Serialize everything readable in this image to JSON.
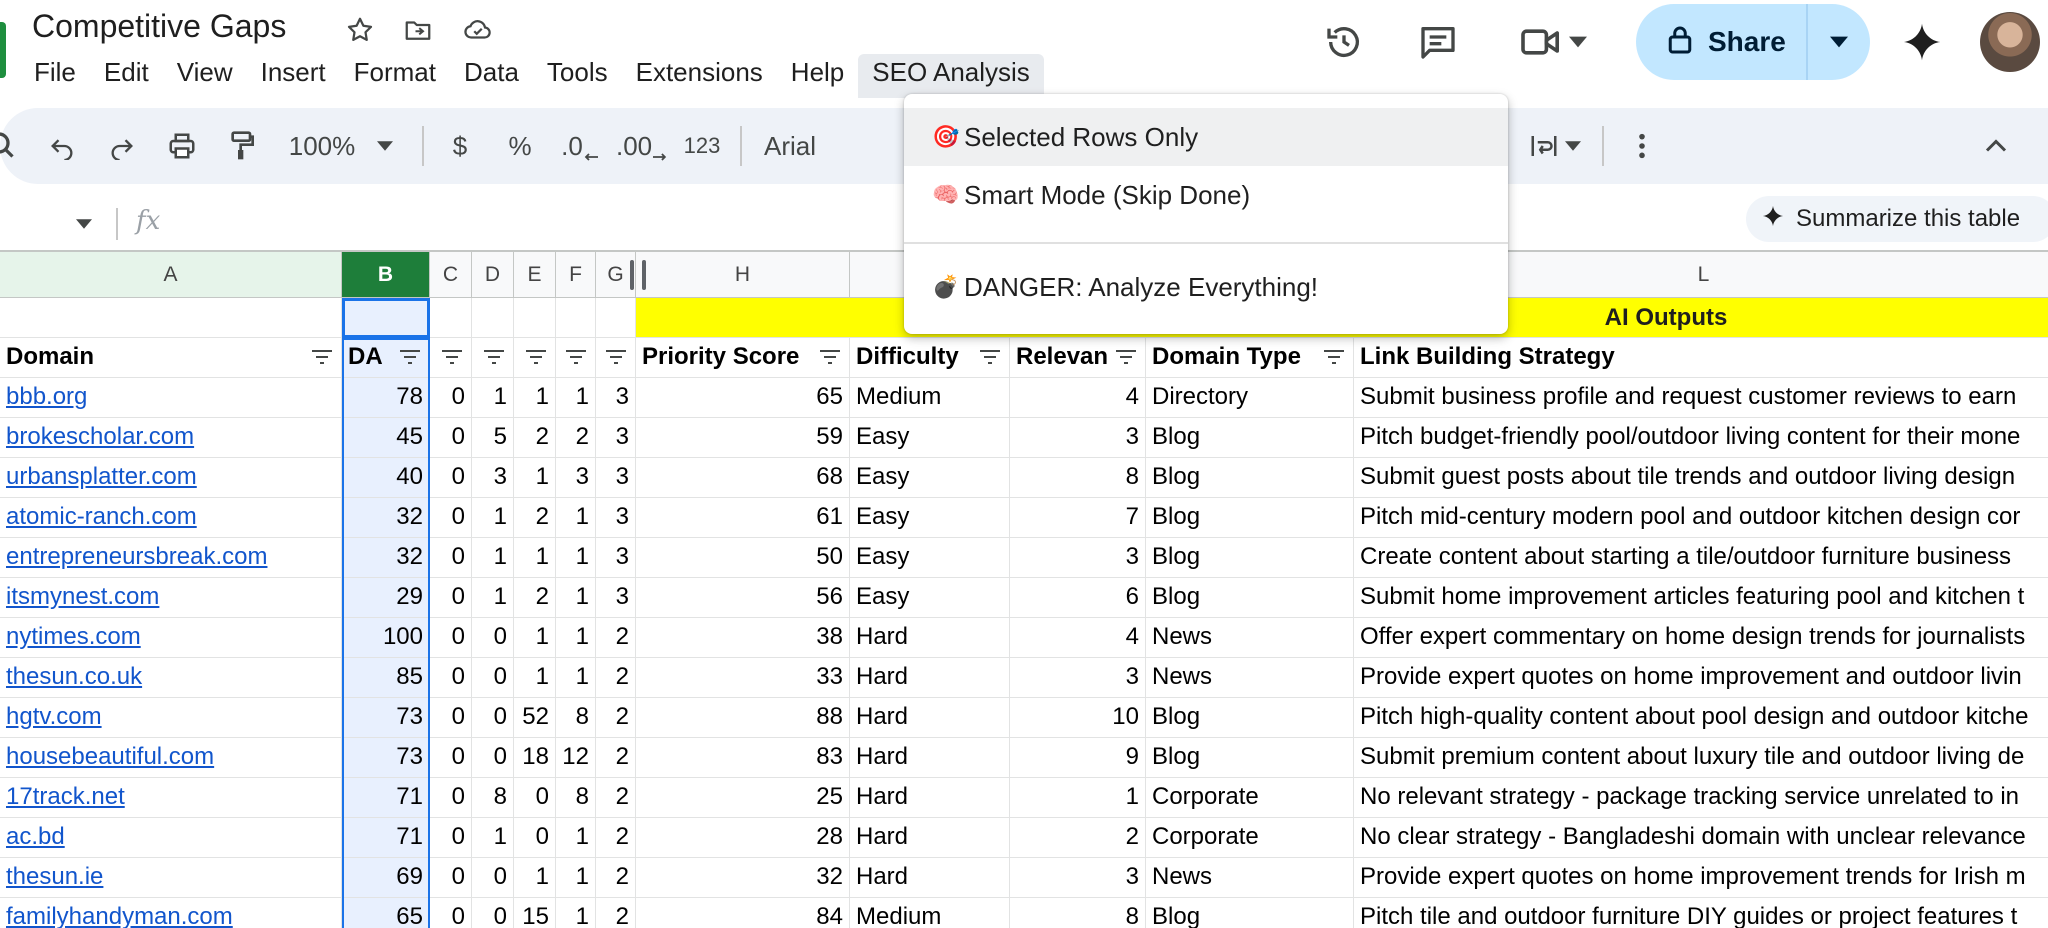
{
  "app": {
    "title": "Competitive Gaps"
  },
  "menu": [
    "File",
    "Edit",
    "View",
    "Insert",
    "Format",
    "Data",
    "Tools",
    "Extensions",
    "Help",
    "SEO Analysis"
  ],
  "share": {
    "label": "Share"
  },
  "toolbar": {
    "zoom": "100%",
    "currency": "$",
    "percent": "%",
    "dec_decrease": ".0",
    "dec_increase": ".00",
    "number_format": "123",
    "font": "Arial"
  },
  "formula_bar": {
    "fx": "fx",
    "summarize_label": "Summarize this table"
  },
  "dropdown": {
    "items": [
      {
        "emoji": "🎯",
        "label": "Selected Rows Only"
      },
      {
        "emoji": "🧠",
        "label": "Smart Mode (Skip Done)"
      },
      {
        "emoji": "💣",
        "label": "DANGER: Analyze Everything!"
      }
    ]
  },
  "grid": {
    "columns": [
      "A",
      "B",
      "C",
      "D",
      "E",
      "F",
      "G",
      "H",
      "L"
    ],
    "ai_outputs_label": "AI Outputs",
    "headers": [
      "Domain",
      "DA",
      "",
      "",
      "",
      "",
      "",
      "Priority Score",
      "Difficulty",
      "Relevan",
      "Domain Type",
      "Link Building Strategy"
    ],
    "rows": [
      [
        "bbb.org",
        "78",
        "0",
        "1",
        "1",
        "1",
        "3",
        "65",
        "Medium",
        "4",
        "Directory",
        "Submit business profile and request customer reviews to earn"
      ],
      [
        "brokescholar.com",
        "45",
        "0",
        "5",
        "2",
        "2",
        "3",
        "59",
        "Easy",
        "3",
        "Blog",
        "Pitch budget-friendly pool/outdoor living content for their mone"
      ],
      [
        "urbansplatter.com",
        "40",
        "0",
        "3",
        "1",
        "3",
        "3",
        "68",
        "Easy",
        "8",
        "Blog",
        "Submit guest posts about tile trends and outdoor living design"
      ],
      [
        "atomic-ranch.com",
        "32",
        "0",
        "1",
        "2",
        "1",
        "3",
        "61",
        "Easy",
        "7",
        "Blog",
        "Pitch mid-century modern pool and outdoor kitchen design cor"
      ],
      [
        "entrepreneursbreak.com",
        "32",
        "0",
        "1",
        "1",
        "1",
        "3",
        "50",
        "Easy",
        "3",
        "Blog",
        "Create content about starting a tile/outdoor furniture business"
      ],
      [
        "itsmynest.com",
        "29",
        "0",
        "1",
        "2",
        "1",
        "3",
        "56",
        "Easy",
        "6",
        "Blog",
        "Submit home improvement articles featuring pool and kitchen t"
      ],
      [
        "nytimes.com",
        "100",
        "0",
        "0",
        "1",
        "1",
        "2",
        "38",
        "Hard",
        "4",
        "News",
        "Offer expert commentary on home design trends for journalists"
      ],
      [
        "thesun.co.uk",
        "85",
        "0",
        "0",
        "1",
        "1",
        "2",
        "33",
        "Hard",
        "3",
        "News",
        "Provide expert quotes on home improvement and outdoor livin"
      ],
      [
        "hgtv.com",
        "73",
        "0",
        "0",
        "52",
        "8",
        "2",
        "88",
        "Hard",
        "10",
        "Blog",
        "Pitch high-quality content about pool design and outdoor kitche"
      ],
      [
        "housebeautiful.com",
        "73",
        "0",
        "0",
        "18",
        "12",
        "2",
        "83",
        "Hard",
        "9",
        "Blog",
        "Submit premium content about luxury tile and outdoor living de"
      ],
      [
        "17track.net",
        "71",
        "0",
        "8",
        "0",
        "8",
        "2",
        "25",
        "Hard",
        "1",
        "Corporate",
        "No relevant strategy - package tracking service unrelated to in"
      ],
      [
        "ac.bd",
        "71",
        "0",
        "1",
        "0",
        "1",
        "2",
        "28",
        "Hard",
        "2",
        "Corporate",
        "No clear strategy - Bangladeshi domain with unclear relevance"
      ],
      [
        "thesun.ie",
        "69",
        "0",
        "0",
        "1",
        "1",
        "2",
        "32",
        "Hard",
        "3",
        "News",
        "Provide expert quotes on home improvement trends for Irish m"
      ],
      [
        "familyhandyman.com",
        "65",
        "0",
        "0",
        "15",
        "1",
        "2",
        "84",
        "Medium",
        "8",
        "Blog",
        "Pitch tile and outdoor furniture DIY guides or project features t"
      ]
    ]
  },
  "colors": {
    "accent_green": "#1e7e3a",
    "share_bg": "#c2e7ff",
    "ai_band": "#ffff00",
    "link": "#1155cc"
  }
}
